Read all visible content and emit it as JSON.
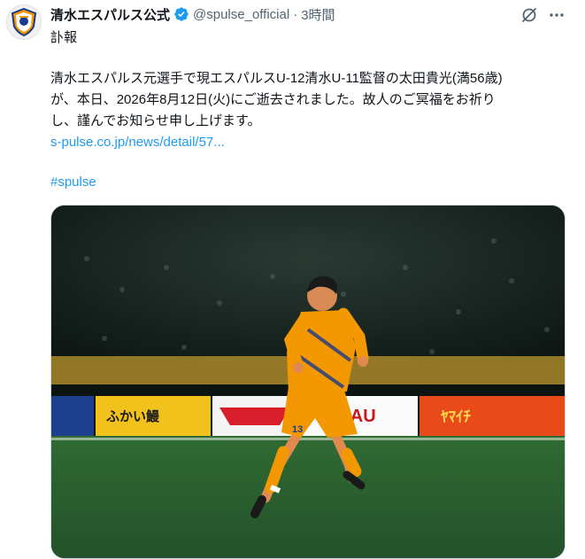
{
  "account": {
    "display_name": "清水エスパルス公式",
    "handle": "@spulse_official",
    "separator": "·",
    "time": "3時間"
  },
  "icons": {
    "verified": "verified-badge-icon",
    "grok": "grok-icon",
    "more": "more-icon"
  },
  "post": {
    "line1": "訃報",
    "line2": "清水エスパルス元選手で現エスパルスU-12清水U-11監督の太田貴光(満56歳)",
    "line3": "が、本日、2026年8月12日(火)にご逝去されました。故人のご冥福をお祈り",
    "line4": "し、謹んでお知らせ申し上げます。",
    "link": "s-pulse.co.jp/news/detail/57...",
    "hashtag": "#spulse"
  },
  "media": {
    "signs": [
      "ふかい鰻",
      "",
      "SAAU",
      "ﾔﾏｲﾁ"
    ],
    "jersey_number": "13"
  },
  "colors": {
    "link": "#1d9bf0",
    "secondary_text": "#536471",
    "brand_orange": "#f39800"
  }
}
